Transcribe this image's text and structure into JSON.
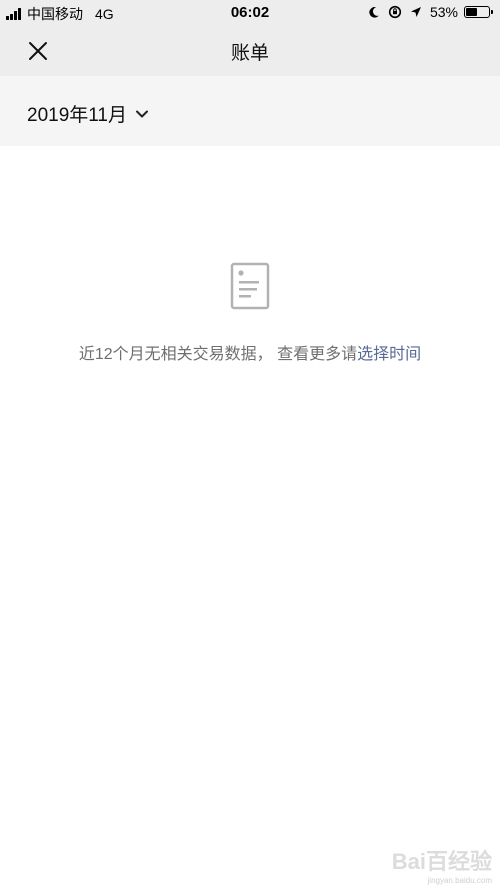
{
  "status_bar": {
    "carrier": "中国移动",
    "network": "4G",
    "time": "06:02",
    "battery": "53%",
    "battery_level": 0.53
  },
  "nav": {
    "title": "账单",
    "close_icon": "close-icon"
  },
  "month_filter": {
    "label": "2019年11月",
    "icon": "chevron-down-icon"
  },
  "empty_state": {
    "icon": "document-icon",
    "message": "近12个月无相关交易数据， 查看更多请",
    "link": "选择时间"
  },
  "watermark": {
    "main": "Bai百经验",
    "sub": "jingyan.baidu.com"
  },
  "colors": {
    "header_bg": "#ededed",
    "filter_bg": "#f5f5f5",
    "link": "#576b95",
    "muted_text": "#6f6f6f",
    "icon_gray": "#b2b2b2"
  }
}
